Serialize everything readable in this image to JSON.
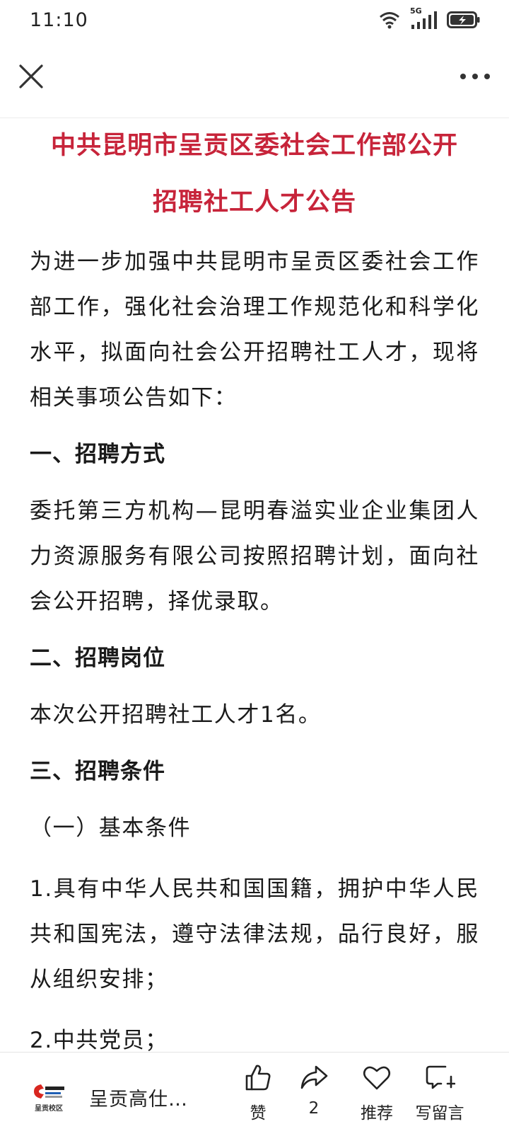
{
  "status_bar": {
    "time": "11:10",
    "network_label": "5G",
    "icons": [
      "wifi-icon",
      "cellular-signal-icon",
      "battery-charging-icon"
    ]
  },
  "nav": {
    "icons": [
      "close-icon",
      "more-icon"
    ]
  },
  "article": {
    "title_line1": "中共昆明市呈贡区委社会工作部公开",
    "title_line2": "招聘社工人才公告",
    "title_color": "#c7243a",
    "intro": "为进一步加强中共昆明市呈贡区委社会工作部工作，强化社会治理工作规范化和科学化水平，拟面向社会公开招聘社工人才，现将相关事项公告如下：",
    "section1_heading": "一、招聘方式",
    "section1_body": "委托第三方机构—昆明春溢实业企业集团人力资源服务有限公司按照招聘计划，面向社会公开招聘，择优录取。",
    "section2_heading": "二、招聘岗位",
    "section2_body": "本次公开招聘社工人才1名。",
    "section3_heading": "三、招聘条件",
    "section3_sub": "（一）基本条件",
    "condition1": "1.具有中华人民共和国国籍，拥护中华人民共和国宪法，遵守法律法规，品行良好，服从组织安排；",
    "condition2": "2.中共党员；"
  },
  "bottom_bar": {
    "account_logo_text": "呈贡校区",
    "account_name": "呈贡高仕…",
    "like_label": "赞",
    "share_count": "2",
    "recommend_label": "推荐",
    "comment_label": "写留言"
  }
}
